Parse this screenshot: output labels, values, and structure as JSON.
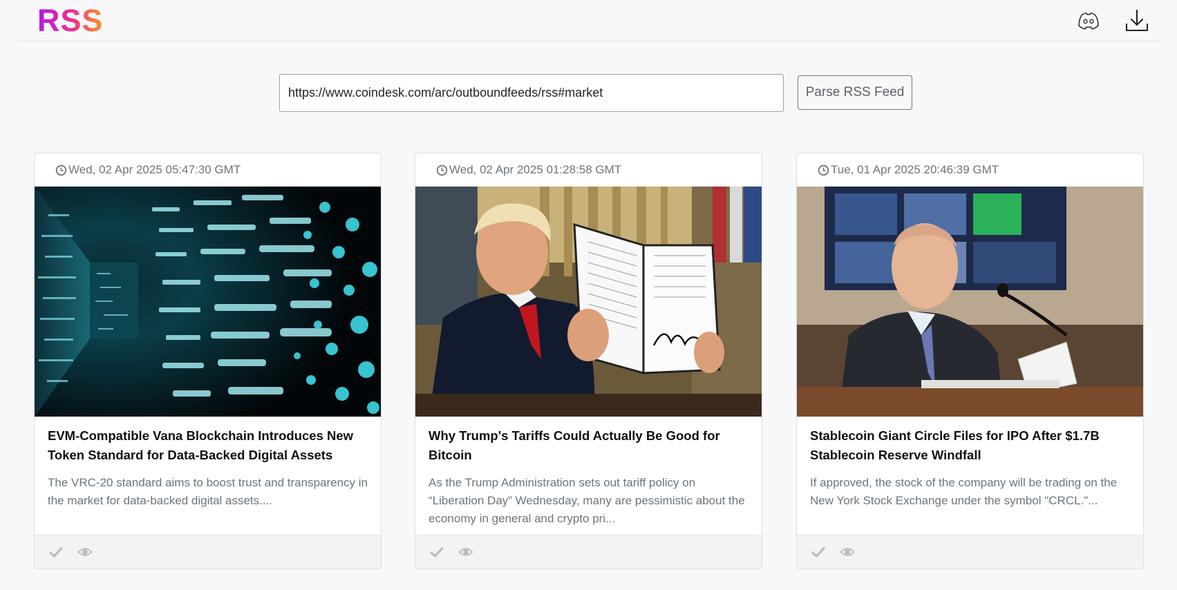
{
  "app": {
    "logo": "RSS"
  },
  "header": {
    "icons": [
      "discord-icon",
      "download-icon"
    ]
  },
  "feed": {
    "url_value": "https://www.coindesk.com/arc/outboundfeeds/rss#market",
    "parse_label": "Parse RSS Feed"
  },
  "cards": [
    {
      "date": "Wed, 02 Apr 2025 05:47:30 GMT",
      "title": "EVM-Compatible Vana Blockchain Introduces New Token Standard for Data-Backed Digital Assets",
      "description": "The VRC-20 standard aims to boost trust and transparency in the market for data-backed digital assets....",
      "image": "digital-data-tunnel"
    },
    {
      "date": "Wed, 02 Apr 2025 01:28:58 GMT",
      "title": "Why Trump's Tariffs Could Actually Be Good for Bitcoin",
      "description": "As the Trump Administration sets out tariff policy on “Liberation Day” Wednesday, many are pessimistic about the economy in general and crypto pri...",
      "image": "man-holding-signed-document"
    },
    {
      "date": "Tue, 01 Apr 2025 20:46:39 GMT",
      "title": "Stablecoin Giant Circle Files for IPO After $1.7B Stablecoin Reserve Windfall",
      "description": "If approved, the stock of the company will be trading on the New York Stock Exchange under the symbol \"CRCL.\"...",
      "image": "man-testifying-at-hearing"
    }
  ],
  "card_actions": [
    "check-icon",
    "eye-icon"
  ],
  "colors": {
    "logo_gradient_start": "#b417e8",
    "logo_gradient_mid": "#f0308a",
    "logo_gradient_end": "#ff9a1f",
    "muted_text": "#6c757d",
    "page_bg": "#f7f8fa"
  }
}
